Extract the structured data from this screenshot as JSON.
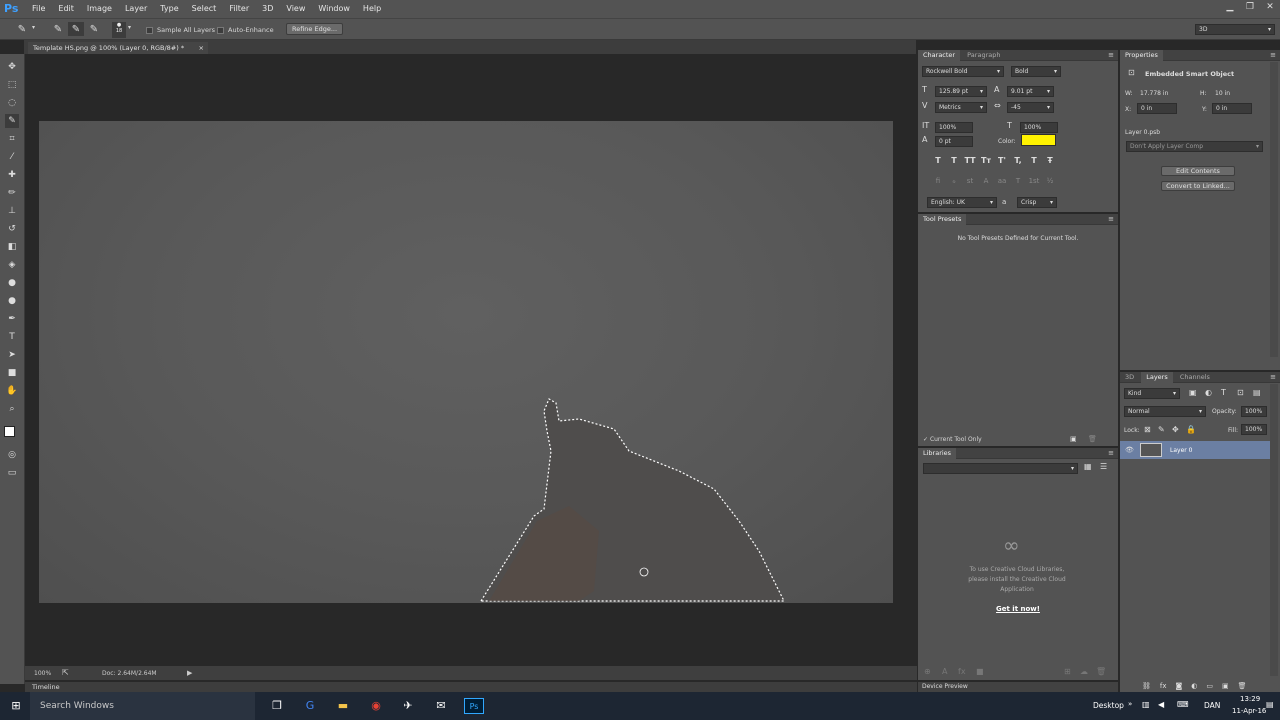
{
  "app": {
    "logo": "Ps"
  },
  "menu": [
    "File",
    "Edit",
    "Image",
    "Layer",
    "Type",
    "Select",
    "Filter",
    "3D",
    "View",
    "Window",
    "Help"
  ],
  "window_controls": [
    "▁",
    "❐",
    "✕"
  ],
  "options": {
    "brush_size": "18",
    "sample_all_layers": "Sample All Layers",
    "auto_enhance": "Auto-Enhance",
    "refine_edge": "Refine Edge...",
    "workspace": "3D"
  },
  "document": {
    "tab_title": "Template HS.png @ 100% (Layer 0, RGB/8#) *",
    "close": "×",
    "zoom": "100%",
    "doc_size": "Doc: 2.64M/2.64M",
    "timeline": "Timeline"
  },
  "character": {
    "tabs": [
      "Character",
      "Paragraph"
    ],
    "font_family": "Rockwell Bold",
    "font_style": "Bold",
    "size": "125.89 pt",
    "leading": "9.01 pt",
    "kerning": "Metrics",
    "tracking": "-45",
    "vscale": "100%",
    "hscale": "100%",
    "baseline": "0 pt",
    "color_label": "Color:",
    "color": "#fff200",
    "language": "English: UK",
    "aa_label": "a",
    "antialias": "Crisp",
    "style_buttons": [
      "T",
      "T",
      "TT",
      "Tт",
      "T'",
      "T,",
      "T",
      "Ŧ"
    ],
    "ot_buttons": [
      "fi",
      "ℴ",
      "st",
      "A",
      "aa",
      "T",
      "1st",
      "½"
    ]
  },
  "tool_presets": {
    "title": "Tool Presets",
    "message": "No Tool Presets Defined for Current Tool.",
    "current_only": "Current Tool Only"
  },
  "libraries": {
    "title": "Libraries",
    "message": "To use Creative Cloud Libraries, please install the Creative Cloud Application",
    "link": "Get it now!"
  },
  "device_preview": {
    "title": "Device Preview"
  },
  "properties": {
    "title": "Properties",
    "object": "Embedded Smart Object",
    "w_label": "W:",
    "w": "17.778 in",
    "h_label": "H:",
    "h": "10 in",
    "x_label": "X:",
    "x": "0 in",
    "y_label": "Y:",
    "y": "0 in",
    "file": "Layer 0.psb",
    "comp": "Don't Apply Layer Comp",
    "edit_contents": "Edit Contents",
    "convert": "Convert to Linked..."
  },
  "layers": {
    "tabs": [
      "3D",
      "Layers",
      "Channels"
    ],
    "filter": "Kind",
    "blend": "Normal",
    "opacity_label": "Opacity:",
    "opacity": "100%",
    "lock_label": "Lock:",
    "fill_label": "Fill:",
    "fill": "100%",
    "layer_name": "Layer 0"
  },
  "taskbar": {
    "search": "Search Windows",
    "desktop": "Desktop",
    "lang": "DAN",
    "time": "13:29",
    "date": "11-Apr-16"
  }
}
